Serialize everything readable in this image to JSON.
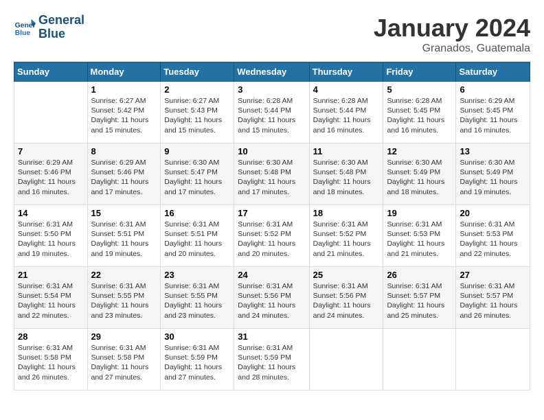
{
  "logo": {
    "line1": "General",
    "line2": "Blue"
  },
  "title": "January 2024",
  "subtitle": "Granados, Guatemala",
  "headers": [
    "Sunday",
    "Monday",
    "Tuesday",
    "Wednesday",
    "Thursday",
    "Friday",
    "Saturday"
  ],
  "weeks": [
    [
      {
        "day": "",
        "info": ""
      },
      {
        "day": "1",
        "info": "Sunrise: 6:27 AM\nSunset: 5:42 PM\nDaylight: 11 hours and 15 minutes."
      },
      {
        "day": "2",
        "info": "Sunrise: 6:27 AM\nSunset: 5:43 PM\nDaylight: 11 hours and 15 minutes."
      },
      {
        "day": "3",
        "info": "Sunrise: 6:28 AM\nSunset: 5:44 PM\nDaylight: 11 hours and 15 minutes."
      },
      {
        "day": "4",
        "info": "Sunrise: 6:28 AM\nSunset: 5:44 PM\nDaylight: 11 hours and 16 minutes."
      },
      {
        "day": "5",
        "info": "Sunrise: 6:28 AM\nSunset: 5:45 PM\nDaylight: 11 hours and 16 minutes."
      },
      {
        "day": "6",
        "info": "Sunrise: 6:29 AM\nSunset: 5:45 PM\nDaylight: 11 hours and 16 minutes."
      }
    ],
    [
      {
        "day": "7",
        "info": "Sunrise: 6:29 AM\nSunset: 5:46 PM\nDaylight: 11 hours and 16 minutes."
      },
      {
        "day": "8",
        "info": "Sunrise: 6:29 AM\nSunset: 5:46 PM\nDaylight: 11 hours and 17 minutes."
      },
      {
        "day": "9",
        "info": "Sunrise: 6:30 AM\nSunset: 5:47 PM\nDaylight: 11 hours and 17 minutes."
      },
      {
        "day": "10",
        "info": "Sunrise: 6:30 AM\nSunset: 5:48 PM\nDaylight: 11 hours and 17 minutes."
      },
      {
        "day": "11",
        "info": "Sunrise: 6:30 AM\nSunset: 5:48 PM\nDaylight: 11 hours and 18 minutes."
      },
      {
        "day": "12",
        "info": "Sunrise: 6:30 AM\nSunset: 5:49 PM\nDaylight: 11 hours and 18 minutes."
      },
      {
        "day": "13",
        "info": "Sunrise: 6:30 AM\nSunset: 5:49 PM\nDaylight: 11 hours and 19 minutes."
      }
    ],
    [
      {
        "day": "14",
        "info": "Sunrise: 6:31 AM\nSunset: 5:50 PM\nDaylight: 11 hours and 19 minutes."
      },
      {
        "day": "15",
        "info": "Sunrise: 6:31 AM\nSunset: 5:51 PM\nDaylight: 11 hours and 19 minutes."
      },
      {
        "day": "16",
        "info": "Sunrise: 6:31 AM\nSunset: 5:51 PM\nDaylight: 11 hours and 20 minutes."
      },
      {
        "day": "17",
        "info": "Sunrise: 6:31 AM\nSunset: 5:52 PM\nDaylight: 11 hours and 20 minutes."
      },
      {
        "day": "18",
        "info": "Sunrise: 6:31 AM\nSunset: 5:52 PM\nDaylight: 11 hours and 21 minutes."
      },
      {
        "day": "19",
        "info": "Sunrise: 6:31 AM\nSunset: 5:53 PM\nDaylight: 11 hours and 21 minutes."
      },
      {
        "day": "20",
        "info": "Sunrise: 6:31 AM\nSunset: 5:53 PM\nDaylight: 11 hours and 22 minutes."
      }
    ],
    [
      {
        "day": "21",
        "info": "Sunrise: 6:31 AM\nSunset: 5:54 PM\nDaylight: 11 hours and 22 minutes."
      },
      {
        "day": "22",
        "info": "Sunrise: 6:31 AM\nSunset: 5:55 PM\nDaylight: 11 hours and 23 minutes."
      },
      {
        "day": "23",
        "info": "Sunrise: 6:31 AM\nSunset: 5:55 PM\nDaylight: 11 hours and 23 minutes."
      },
      {
        "day": "24",
        "info": "Sunrise: 6:31 AM\nSunset: 5:56 PM\nDaylight: 11 hours and 24 minutes."
      },
      {
        "day": "25",
        "info": "Sunrise: 6:31 AM\nSunset: 5:56 PM\nDaylight: 11 hours and 24 minutes."
      },
      {
        "day": "26",
        "info": "Sunrise: 6:31 AM\nSunset: 5:57 PM\nDaylight: 11 hours and 25 minutes."
      },
      {
        "day": "27",
        "info": "Sunrise: 6:31 AM\nSunset: 5:57 PM\nDaylight: 11 hours and 26 minutes."
      }
    ],
    [
      {
        "day": "28",
        "info": "Sunrise: 6:31 AM\nSunset: 5:58 PM\nDaylight: 11 hours and 26 minutes."
      },
      {
        "day": "29",
        "info": "Sunrise: 6:31 AM\nSunset: 5:58 PM\nDaylight: 11 hours and 27 minutes."
      },
      {
        "day": "30",
        "info": "Sunrise: 6:31 AM\nSunset: 5:59 PM\nDaylight: 11 hours and 27 minutes."
      },
      {
        "day": "31",
        "info": "Sunrise: 6:31 AM\nSunset: 5:59 PM\nDaylight: 11 hours and 28 minutes."
      },
      {
        "day": "",
        "info": ""
      },
      {
        "day": "",
        "info": ""
      },
      {
        "day": "",
        "info": ""
      }
    ]
  ]
}
